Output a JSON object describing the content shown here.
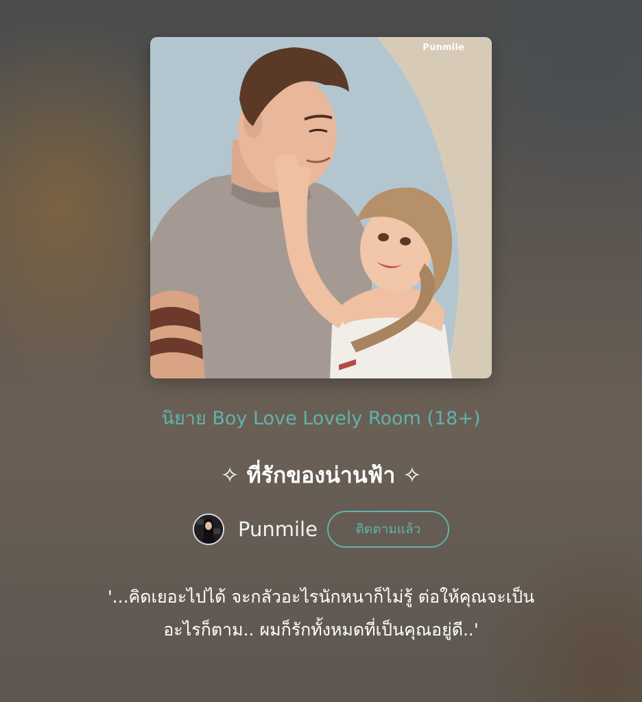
{
  "cover": {
    "watermark": "Punmile",
    "colors": {
      "sky": "#b3c6cf",
      "wall": "#d7cbb8",
      "skin": "#e9b79a",
      "shirt": "#a49a93",
      "hair_man": "#5a3a26",
      "hair_woman": "#b59068"
    }
  },
  "story": {
    "category": "นิยาย Boy Love Lovely Room (18+)",
    "title": "✧ ที่รักของน่านฟ้า ✧",
    "synopsis_line1": "'...คิดเยอะไปได้ จะกลัวอะไรนักหนาก็ไม่รู้ ต่อให้คุณจะเป็น",
    "synopsis_line2": "อะไรก็ตาม.. ผมก็รักทั้งหมดที่เป็นคุณอยู่ดี..'"
  },
  "author": {
    "name": "Punmile",
    "follow_label": "ติดตามแล้ว"
  },
  "theme": {
    "accent": "#5fb3ad",
    "text": "#ffffff"
  }
}
